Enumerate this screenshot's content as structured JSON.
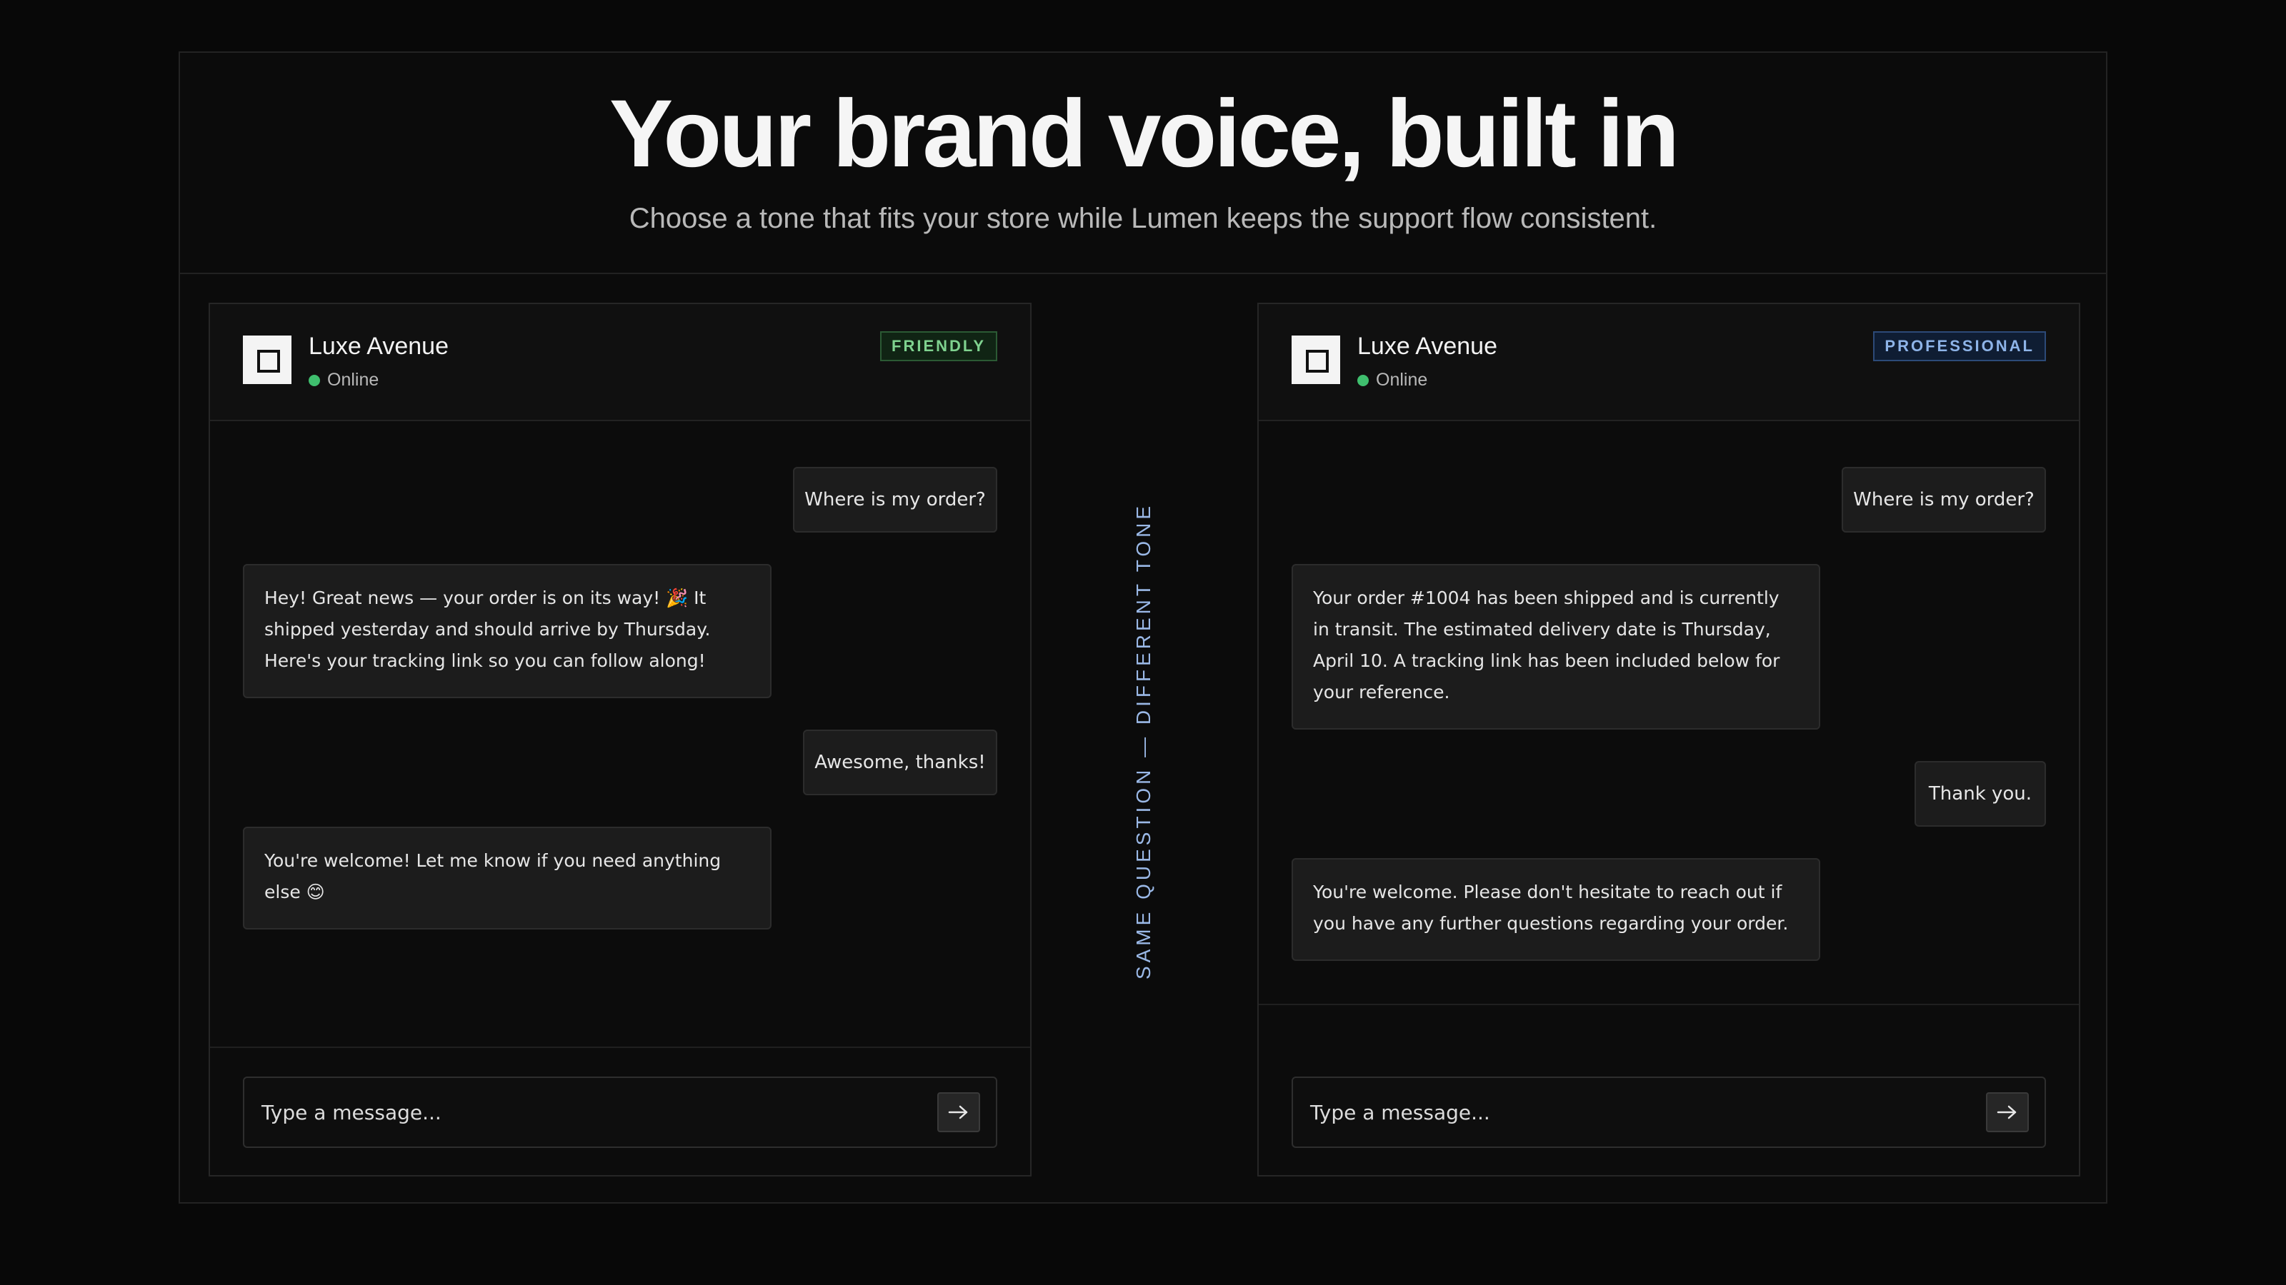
{
  "hero": {
    "title": "Your brand voice, built in",
    "subtitle": "Choose a tone that fits your store while Lumen keeps the support flow consistent."
  },
  "divider_label": "SAME QUESTION — DIFFERENT TONE",
  "colors": {
    "background": "#080808",
    "online_dot": "#3fbf6e",
    "friendly_badge": "#7fd28f",
    "professional_badge": "#8eb4e8",
    "divider_text": "#9ab8e6"
  },
  "panels": [
    {
      "brand": "Luxe Avenue",
      "status": "Online",
      "tone_badge": "FRIENDLY",
      "messages": [
        {
          "from": "user",
          "text": "Where is my order?"
        },
        {
          "from": "bot",
          "text": "Hey! Great news — your order is on its way! 🎉 It shipped yesterday and should arrive by Thursday. Here's your tracking link so you can follow along!"
        },
        {
          "from": "user",
          "text": "Awesome, thanks!"
        },
        {
          "from": "bot",
          "text": "You're welcome! Let me know if you need anything else 😊"
        }
      ],
      "composer_placeholder": "Type a message...",
      "send_icon": "arrow-right-icon"
    },
    {
      "brand": "Luxe Avenue",
      "status": "Online",
      "tone_badge": "PROFESSIONAL",
      "messages": [
        {
          "from": "user",
          "text": "Where is my order?"
        },
        {
          "from": "bot",
          "text": "Your order #1004 has been shipped and is currently in transit. The estimated delivery date is Thursday, April 10. A tracking link has been included below for your reference."
        },
        {
          "from": "user",
          "text": "Thank you."
        },
        {
          "from": "bot",
          "text": "You're welcome. Please don't hesitate to reach out if you have any further questions regarding your order."
        }
      ],
      "composer_placeholder": "Type a message...",
      "send_icon": "arrow-right-icon"
    }
  ]
}
